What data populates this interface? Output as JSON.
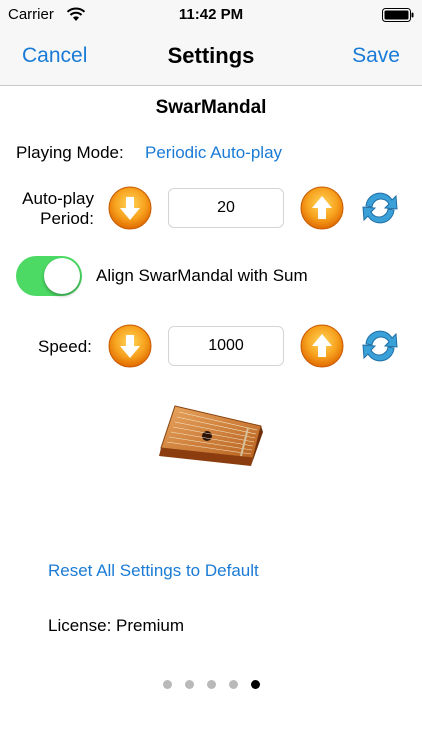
{
  "status_bar": {
    "carrier": "Carrier",
    "time": "11:42 PM"
  },
  "nav": {
    "cancel_label": "Cancel",
    "title": "Settings",
    "save_label": "Save"
  },
  "section_title": "SwarMandal",
  "playing_mode": {
    "label": "Playing Mode:",
    "value": "Periodic Auto-play"
  },
  "auto_play_period": {
    "label_line1": "Auto-play",
    "label_line2": "Period:",
    "value": "20"
  },
  "align_toggle": {
    "label": "Align SwarMandal with Sum",
    "on": true
  },
  "speed": {
    "label": "Speed:",
    "value": "1000"
  },
  "reset_link": "Reset All Settings to Default",
  "license": "License: Premium",
  "page_indicator": {
    "count": 5,
    "current": 5
  },
  "colors": {
    "accent": "#1a7bd6",
    "toggle_on": "#4cd964",
    "orange_button": "#f28c14",
    "reset_icon": "#3aa0d8"
  }
}
